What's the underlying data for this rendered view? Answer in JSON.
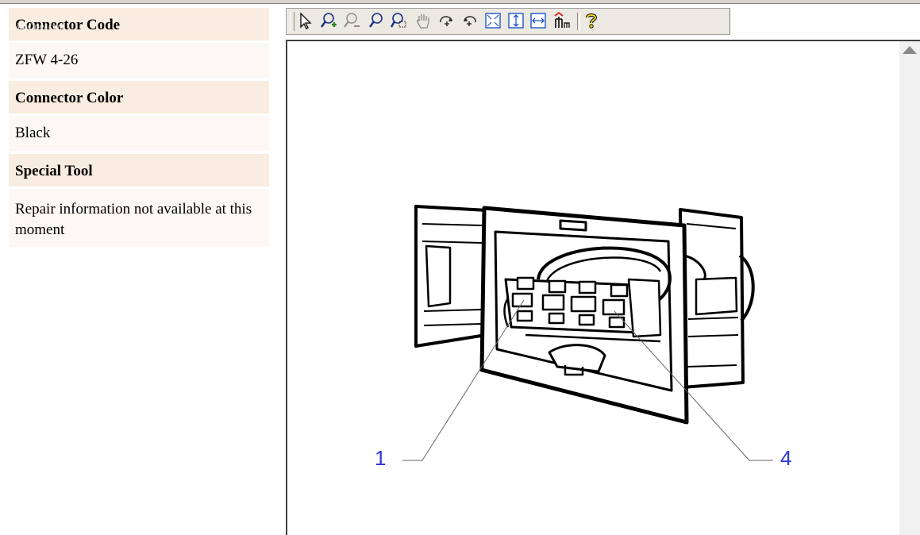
{
  "info": {
    "connector_code_label": "Connector Code",
    "connector_code": "ZFW 4-26",
    "connector_color_label": "Connector Color",
    "connector_color": "Black",
    "special_tool_label": "Special Tool",
    "special_tool": "Repair information not available at this moment"
  },
  "watermark": "ClubOpel.com",
  "toolbar": {
    "tools": [
      "select-icon",
      "zoom-in-icon",
      "zoom-out-icon",
      "zoom-icon",
      "zoom-region-icon",
      "pan-hand-icon",
      "rotate-cw-icon",
      "rotate-ccw-icon",
      "fit-all-icon",
      "fit-height-icon",
      "fit-width-icon",
      "tree-icon",
      "help-icon"
    ]
  },
  "diagram": {
    "callouts": [
      {
        "label": "1"
      },
      {
        "label": "4"
      }
    ]
  },
  "colors": {
    "label_bg": "#f9ece0",
    "value_bg": "#fdf8f4",
    "callout": "#2d39d6"
  }
}
